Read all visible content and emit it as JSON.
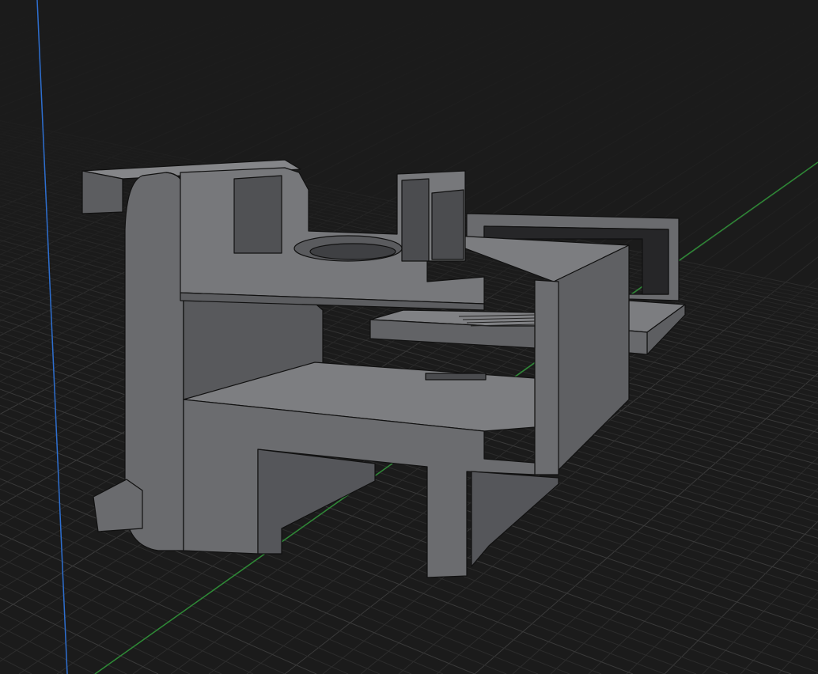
{
  "viewport": {
    "background": "#1b1b1b",
    "grid_minor_color": "#2c2c2c",
    "grid_major_color": "#3a3a3a",
    "axis_x_color": "#2e8a36",
    "axis_z_color": "#2e6fd0"
  },
  "model": {
    "face_top_color": "#7a7b7e",
    "face_front_color": "#68696c",
    "face_side_color": "#58595c",
    "face_dark_color": "#3e3f42",
    "edge_color": "#111111"
  }
}
